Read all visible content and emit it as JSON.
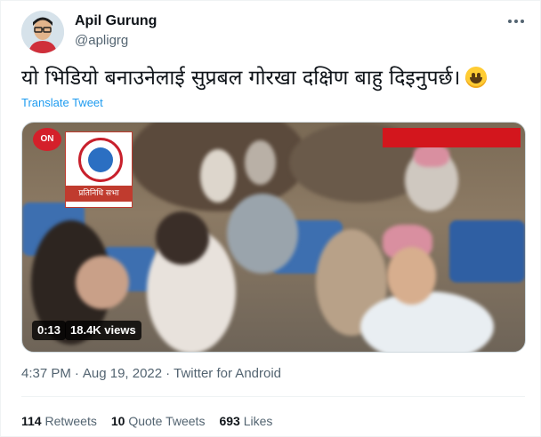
{
  "author": {
    "name": "Apil Gurung",
    "handle": "@apligrg"
  },
  "tweet": {
    "text": "यो भिडियो बनाउनेलाई सुप्रबल गोरखा दक्षिण बाहु दिइनुपर्छ।",
    "emoji": "grinning-face-emoji",
    "translate_label": "Translate Tweet"
  },
  "video": {
    "duration": "0:13",
    "views": "18.4K views",
    "channel_mark": "ON",
    "logo_caption": "प्रतिनिधि सभा"
  },
  "meta": {
    "time": "4:37 PM",
    "date": "Aug 19, 2022",
    "source": "Twitter for Android",
    "separator": "·"
  },
  "stats": {
    "retweets_count": "114",
    "retweets_label": "Retweets",
    "quotes_count": "10",
    "quotes_label": "Quote Tweets",
    "likes_count": "693",
    "likes_label": "Likes"
  },
  "colors": {
    "link": "#1d9bf0",
    "secondary_text": "#536471",
    "primary_text": "#0f1419"
  }
}
